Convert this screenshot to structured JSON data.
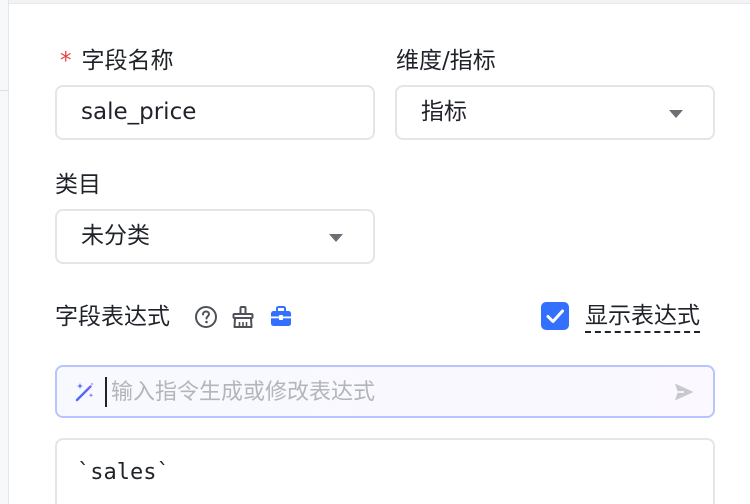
{
  "form": {
    "field_name": {
      "required_mark": "*",
      "label": "字段名称",
      "value": "sale_price"
    },
    "dimension_metric": {
      "label": "维度/指标",
      "value": "指标"
    },
    "category": {
      "label": "类目",
      "value": "未分类"
    },
    "expression": {
      "label": "字段表达式",
      "icons": [
        "help-icon",
        "broom-icon",
        "toolbox-icon"
      ],
      "show_expression": {
        "checked": true,
        "label": "显示表达式"
      }
    },
    "ai_prompt": {
      "placeholder": "输入指令生成或修改表达式",
      "value": ""
    },
    "code": "`sales`"
  },
  "colors": {
    "accent": "#3370ff",
    "required": "#e54545",
    "prompt_border": "#b9c3ff",
    "border": "#e3e5e9",
    "text": "#1f2329",
    "placeholder": "#b2b5bb"
  }
}
